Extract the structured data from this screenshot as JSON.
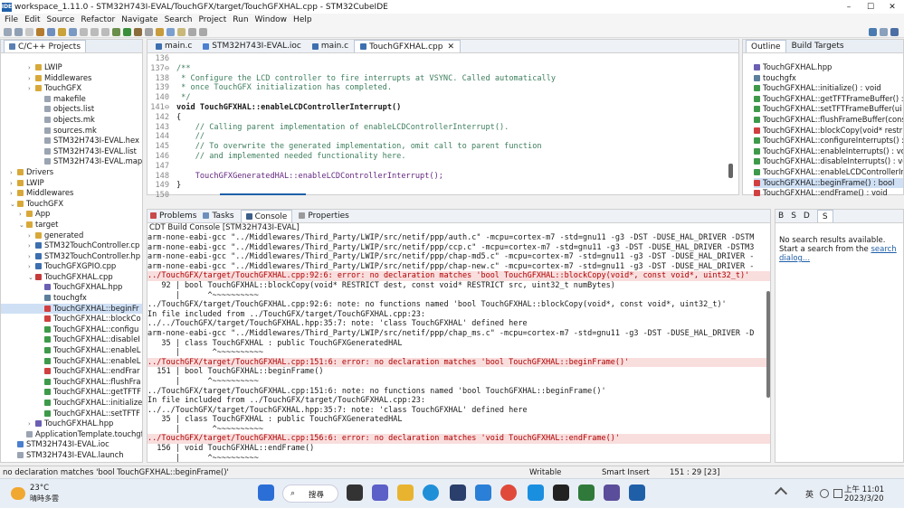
{
  "window": {
    "title": "workspace_1.11.0 - STM32H743I-EVAL/TouchGFX/target/TouchGFXHAL.cpp - STM32CubeIDE",
    "app_icon": "IDE",
    "minimize": "–",
    "maximize": "☐",
    "close": "✕"
  },
  "menu": [
    "File",
    "Edit",
    "Source",
    "Refactor",
    "Navigate",
    "Search",
    "Project",
    "Run",
    "Window",
    "Help"
  ],
  "project_explorer": {
    "tab": "C/C++ Projects",
    "items": [
      {
        "label": "LWIP",
        "indent": 3,
        "arrow": "›",
        "icon": "folder"
      },
      {
        "label": "Middlewares",
        "indent": 3,
        "arrow": "›",
        "icon": "folder"
      },
      {
        "label": "TouchGFX",
        "indent": 3,
        "arrow": "›",
        "icon": "folder"
      },
      {
        "label": "makefile",
        "indent": 4,
        "arrow": "",
        "icon": "file"
      },
      {
        "label": "objects.list",
        "indent": 4,
        "arrow": "",
        "icon": "file"
      },
      {
        "label": "objects.mk",
        "indent": 4,
        "arrow": "",
        "icon": "file"
      },
      {
        "label": "sources.mk",
        "indent": 4,
        "arrow": "",
        "icon": "file"
      },
      {
        "label": "STM32H743I-EVAL.hex",
        "indent": 4,
        "arrow": "",
        "icon": "file"
      },
      {
        "label": "STM32H743I-EVAL.list",
        "indent": 4,
        "arrow": "",
        "icon": "file"
      },
      {
        "label": "STM32H743I-EVAL.map",
        "indent": 4,
        "arrow": "",
        "icon": "file"
      },
      {
        "label": "Drivers",
        "indent": 1,
        "arrow": "›",
        "icon": "folder"
      },
      {
        "label": "LWIP",
        "indent": 1,
        "arrow": "›",
        "icon": "folder"
      },
      {
        "label": "Middlewares",
        "indent": 1,
        "arrow": "›",
        "icon": "folder"
      },
      {
        "label": "TouchGFX",
        "indent": 1,
        "arrow": "⌄",
        "icon": "folder"
      },
      {
        "label": "App",
        "indent": 2,
        "arrow": "›",
        "icon": "folder"
      },
      {
        "label": "target",
        "indent": 2,
        "arrow": "⌄",
        "icon": "folder"
      },
      {
        "label": "generated",
        "indent": 3,
        "arrow": "›",
        "icon": "folder"
      },
      {
        "label": "STM32TouchController.cp",
        "indent": 3,
        "arrow": "›",
        "icon": "cpp"
      },
      {
        "label": "STM32TouchController.hp",
        "indent": 3,
        "arrow": "›",
        "icon": "cpp"
      },
      {
        "label": "TouchGFXGPIO.cpp",
        "indent": 3,
        "arrow": "›",
        "icon": "cpp"
      },
      {
        "label": "TouchGFXHAL.cpp",
        "indent": 3,
        "arrow": "⌄",
        "icon": "cpperr"
      },
      {
        "label": "TouchGFXHAL.hpp",
        "indent": 4,
        "arrow": "",
        "icon": "h"
      },
      {
        "label": "touchgfx",
        "indent": 4,
        "arrow": "",
        "icon": "ns"
      },
      {
        "label": "TouchGFXHAL::beginFr",
        "indent": 4,
        "arrow": "",
        "icon": "err",
        "selected": true
      },
      {
        "label": "TouchGFXHAL::blockCo",
        "indent": 4,
        "arrow": "",
        "icon": "err"
      },
      {
        "label": "TouchGFXHAL::configu",
        "indent": 4,
        "arrow": "",
        "icon": "method"
      },
      {
        "label": "TouchGFXHAL::disableI",
        "indent": 4,
        "arrow": "",
        "icon": "method"
      },
      {
        "label": "TouchGFXHAL::enableL",
        "indent": 4,
        "arrow": "",
        "icon": "method"
      },
      {
        "label": "TouchGFXHAL::enableL",
        "indent": 4,
        "arrow": "",
        "icon": "method"
      },
      {
        "label": "TouchGFXHAL::endFrar",
        "indent": 4,
        "arrow": "",
        "icon": "err"
      },
      {
        "label": "TouchGFXHAL::flushFra",
        "indent": 4,
        "arrow": "",
        "icon": "method"
      },
      {
        "label": "TouchGFXHAL::getTFTF",
        "indent": 4,
        "arrow": "",
        "icon": "method"
      },
      {
        "label": "TouchGFXHAL::initialize",
        "indent": 4,
        "arrow": "",
        "icon": "method"
      },
      {
        "label": "TouchGFXHAL::setTFTF",
        "indent": 4,
        "arrow": "",
        "icon": "method"
      },
      {
        "label": "TouchGFXHAL.hpp",
        "indent": 3,
        "arrow": "›",
        "icon": "h"
      },
      {
        "label": "ApplicationTemplate.touchgf",
        "indent": 2,
        "arrow": "",
        "icon": "file"
      },
      {
        "label": "STM32H743I-EVAL.ioc",
        "indent": 1,
        "arrow": "",
        "icon": "ioc"
      },
      {
        "label": "STM32H743I-EVAL.launch",
        "indent": 1,
        "arrow": "",
        "icon": "file"
      }
    ]
  },
  "editor": {
    "tabs": [
      {
        "label": "main.c",
        "active": false
      },
      {
        "label": "STM32H743I-EVAL.ioc",
        "active": false
      },
      {
        "label": "main.c",
        "active": false
      },
      {
        "label": "TouchGFXHAL.cpp",
        "active": true,
        "close": "✕"
      }
    ],
    "lines": [
      {
        "n": "136",
        "t": ""
      },
      {
        "n": "137⊖",
        "t": "/**",
        "c": "cm"
      },
      {
        "n": "138",
        "t": " * Configure the LCD controller to fire interrupts at VSYNC. Called automatically",
        "c": "cm"
      },
      {
        "n": "139",
        "t": " * once TouchGFX initialization has completed.",
        "c": "cm"
      },
      {
        "n": "140",
        "t": " */",
        "c": "cm"
      },
      {
        "n": "141⊖",
        "t": "void TouchGFXHAL::enableLCDControllerInterrupt()",
        "c": "sig"
      },
      {
        "n": "142",
        "t": "{"
      },
      {
        "n": "143",
        "t": "    // Calling parent implementation of enableLCDControllerInterrupt().",
        "c": "cm"
      },
      {
        "n": "144",
        "t": "    //",
        "c": "cm"
      },
      {
        "n": "145",
        "t": "    // To overwrite the generated implementation, omit call to parent function",
        "c": "cm"
      },
      {
        "n": "146",
        "t": "    // and implemented needed functionality here.",
        "c": "cm"
      },
      {
        "n": "147",
        "t": ""
      },
      {
        "n": "148",
        "t": "    TouchGFXGeneratedHAL::enableLCDControllerInterrupt();",
        "c": "call"
      },
      {
        "n": "149",
        "t": "}"
      },
      {
        "n": "150",
        "t": ""
      }
    ]
  },
  "outline": {
    "tabs": [
      "Outline",
      "Build Targets"
    ],
    "items": [
      {
        "label": "TouchGFXHAL.hpp",
        "icon": "h"
      },
      {
        "label": "touchgfx",
        "icon": "ns"
      },
      {
        "label": "TouchGFXHAL::initialize() : void",
        "icon": "method"
      },
      {
        "label": "TouchGFXHAL::getTFTFrameBuffer() : u",
        "icon": "method"
      },
      {
        "label": "TouchGFXHAL::setTFTFrameBuffer(ui",
        "icon": "method"
      },
      {
        "label": "TouchGFXHAL::flushFrameBuffer(const",
        "icon": "method"
      },
      {
        "label": "TouchGFXHAL::blockCopy(void* restric",
        "icon": "err"
      },
      {
        "label": "TouchGFXHAL::configureInterrupts() : v",
        "icon": "method"
      },
      {
        "label": "TouchGFXHAL::enableInterrupts() : void",
        "icon": "method"
      },
      {
        "label": "TouchGFXHAL::disableInterrupts() : void",
        "icon": "method"
      },
      {
        "label": "TouchGFXHAL::enableLCDControllerInt",
        "icon": "method"
      },
      {
        "label": "TouchGFXHAL::beginFrame() : bool",
        "icon": "err",
        "selected": true
      },
      {
        "label": "TouchGFXHAL::endFrame() : void",
        "icon": "err"
      }
    ]
  },
  "console": {
    "tabs": [
      "Problems",
      "Tasks",
      "Console",
      "Properties"
    ],
    "title": "CDT Build Console [STM32H743I-EVAL]",
    "lines": [
      {
        "t": "arm-none-eabi-gcc \"../Middlewares/Third_Party/LWIP/src/netif/ppp/auth.c\" -mcpu=cortex-m7 -std=gnu11 -g3 -DST -DUSE_HAL_DRIVER -DSTM"
      },
      {
        "t": "arm-none-eabi-gcc \"../Middlewares/Third_Party/LWIP/src/netif/ppp/ccp.c\" -mcpu=cortex-m7 -std=gnu11 -g3 -DST -DUSE_HAL_DRIVER -DSTM3"
      },
      {
        "t": "arm-none-eabi-gcc \"../Middlewares/Third_Party/LWIP/src/netif/ppp/chap-md5.c\" -mcpu=cortex-m7 -std=gnu11 -g3 -DST -DUSE_HAL_DRIVER -"
      },
      {
        "t": "arm-none-eabi-gcc \"../Middlewares/Third_Party/LWIP/src/netif/ppp/chap-new.c\" -mcpu=cortex-m7 -std=gnu11 -g3 -DST -DUSE_HAL_DRIVER -"
      },
      {
        "t": "../TouchGFX/target/TouchGFXHAL.cpp:92:6: error: no declaration matches 'bool TouchGFXHAL::blockCopy(void*, const void*, uint32_t)'",
        "err": true
      },
      {
        "t": "   92 | bool TouchGFXHAL::blockCopy(void* RESTRICT dest, const void* RESTRICT src, uint32_t numBytes)"
      },
      {
        "t": "      |      ^~~~~~~~~~~"
      },
      {
        "t": "../TouchGFX/target/TouchGFXHAL.cpp:92:6: note: no functions named 'bool TouchGFXHAL::blockCopy(void*, const void*, uint32_t)'"
      },
      {
        "t": "In file included from ../TouchGFX/target/TouchGFXHAL.cpp:23:"
      },
      {
        "t": "../../TouchGFX/target/TouchGFXHAL.hpp:35:7: note: 'class TouchGFXHAL' defined here"
      },
      {
        "t": "arm-none-eabi-gcc \"../Middlewares/Third_Party/LWIP/src/netif/ppp/chap_ms.c\" -mcpu=cortex-m7 -std=gnu11 -g3 -DST -DUSE_HAL_DRIVER -D"
      },
      {
        "t": "   35 | class TouchGFXHAL : public TouchGFXGeneratedHAL"
      },
      {
        "t": "      |       ^~~~~~~~~~~"
      },
      {
        "t": "../TouchGFX/target/TouchGFXHAL.cpp:151:6: error: no declaration matches 'bool TouchGFXHAL::beginFrame()'",
        "err": true
      },
      {
        "t": "  151 | bool TouchGFXHAL::beginFrame()"
      },
      {
        "t": "      |      ^~~~~~~~~~~"
      },
      {
        "t": "../TouchGFX/target/TouchGFXHAL.cpp:151:6: note: no functions named 'bool TouchGFXHAL::beginFrame()'"
      },
      {
        "t": "In file included from ../TouchGFX/target/TouchGFXHAL.cpp:23:"
      },
      {
        "t": "../../TouchGFX/target/TouchGFXHAL.hpp:35:7: note: 'class TouchGFXHAL' defined here"
      },
      {
        "t": "   35 | class TouchGFXHAL : public TouchGFXGeneratedHAL"
      },
      {
        "t": "      |       ^~~~~~~~~~~"
      },
      {
        "t": "../TouchGFX/target/TouchGFXHAL.cpp:156:6: error: no declaration matches 'void TouchGFXHAL::endFrame()'",
        "err": true
      },
      {
        "t": "  156 | void TouchGFXHAL::endFrame()"
      },
      {
        "t": "      |      ^~~~~~~~~~~"
      }
    ]
  },
  "search": {
    "tabs": [
      "B",
      "S",
      "D",
      "S"
    ],
    "text_before": "No search results available. Start a search from the ",
    "link": "search dialog...",
    "text_after": ""
  },
  "status": {
    "message": "no declaration matches 'bool TouchGFXHAL::beginFrame()'",
    "mode": "Writable",
    "insert": "Smart Insert",
    "position": "151 : 29 [23]"
  },
  "taskbar": {
    "weather_temp": "23°C",
    "weather_desc": "晴時多雲",
    "search_label": "搜尋",
    "ime": "英",
    "time": "上午 11:01",
    "date": "2023/3/20"
  },
  "colors": {
    "accent": "#1f5fa8",
    "error_bg": "#f9dede",
    "error_text": "#b00000",
    "comment": "#3f7f5f",
    "keyword": "#7f0055"
  }
}
